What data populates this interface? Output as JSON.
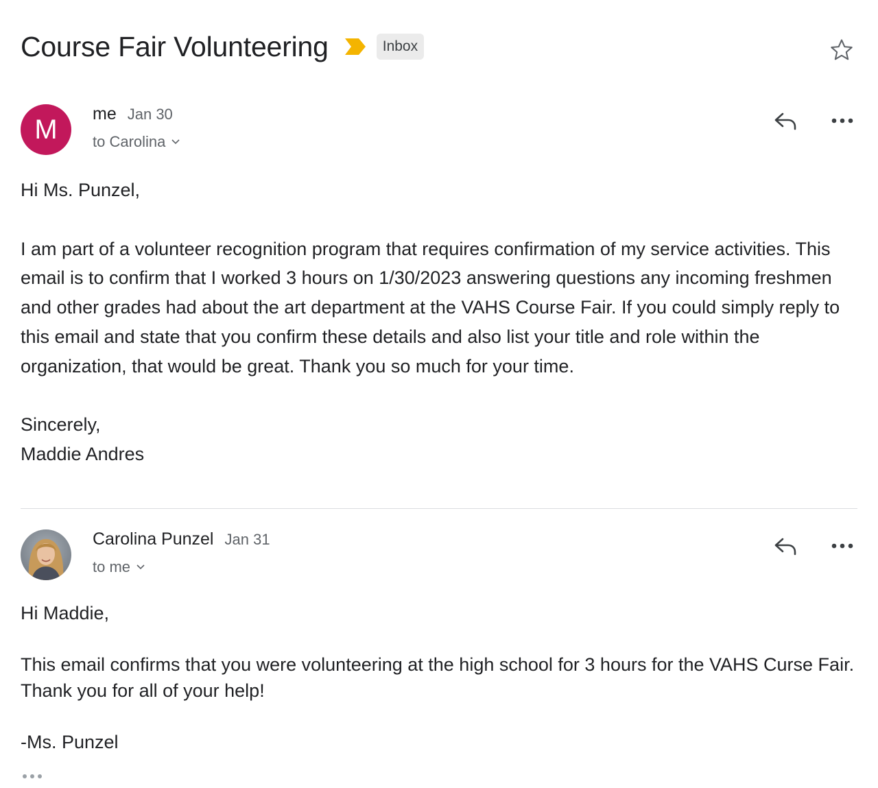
{
  "thread": {
    "subject": "Course Fair Volunteering",
    "label": "Inbox",
    "importance_icon": "importance-marker-icon",
    "importance_color": "#f4b400",
    "star_icon": "star-outline-icon"
  },
  "messages": [
    {
      "avatar_letter": "M",
      "avatar_color": "#c2185b",
      "sender": "me",
      "date": "Jan 30",
      "recipient": "to Carolina",
      "body": {
        "greeting": "Hi Ms. Punzel,",
        "paragraph": "I am part of a volunteer recognition program that requires confirmation of my service activities. This email is to confirm that I worked 3 hours on 1/30/2023 answering questions any incoming freshmen and other grades had about the art department at the VAHS Course Fair. If you could simply reply to this email and state that you confirm these details and also list your title and role within the organization, that would be great. Thank you so much for your time.",
        "closing": "Sincerely,",
        "signature": "Maddie Andres"
      }
    },
    {
      "avatar": "profile-photo",
      "sender": "Carolina Punzel",
      "date": "Jan 31",
      "recipient": "to me",
      "body": {
        "greeting": "Hi Maddie,",
        "paragraph": "This email confirms that you were volunteering at the high school for 3 hours for the VAHS Curse Fair. Thank you for all of your help!",
        "signature": "-Ms. Punzel"
      }
    }
  ]
}
